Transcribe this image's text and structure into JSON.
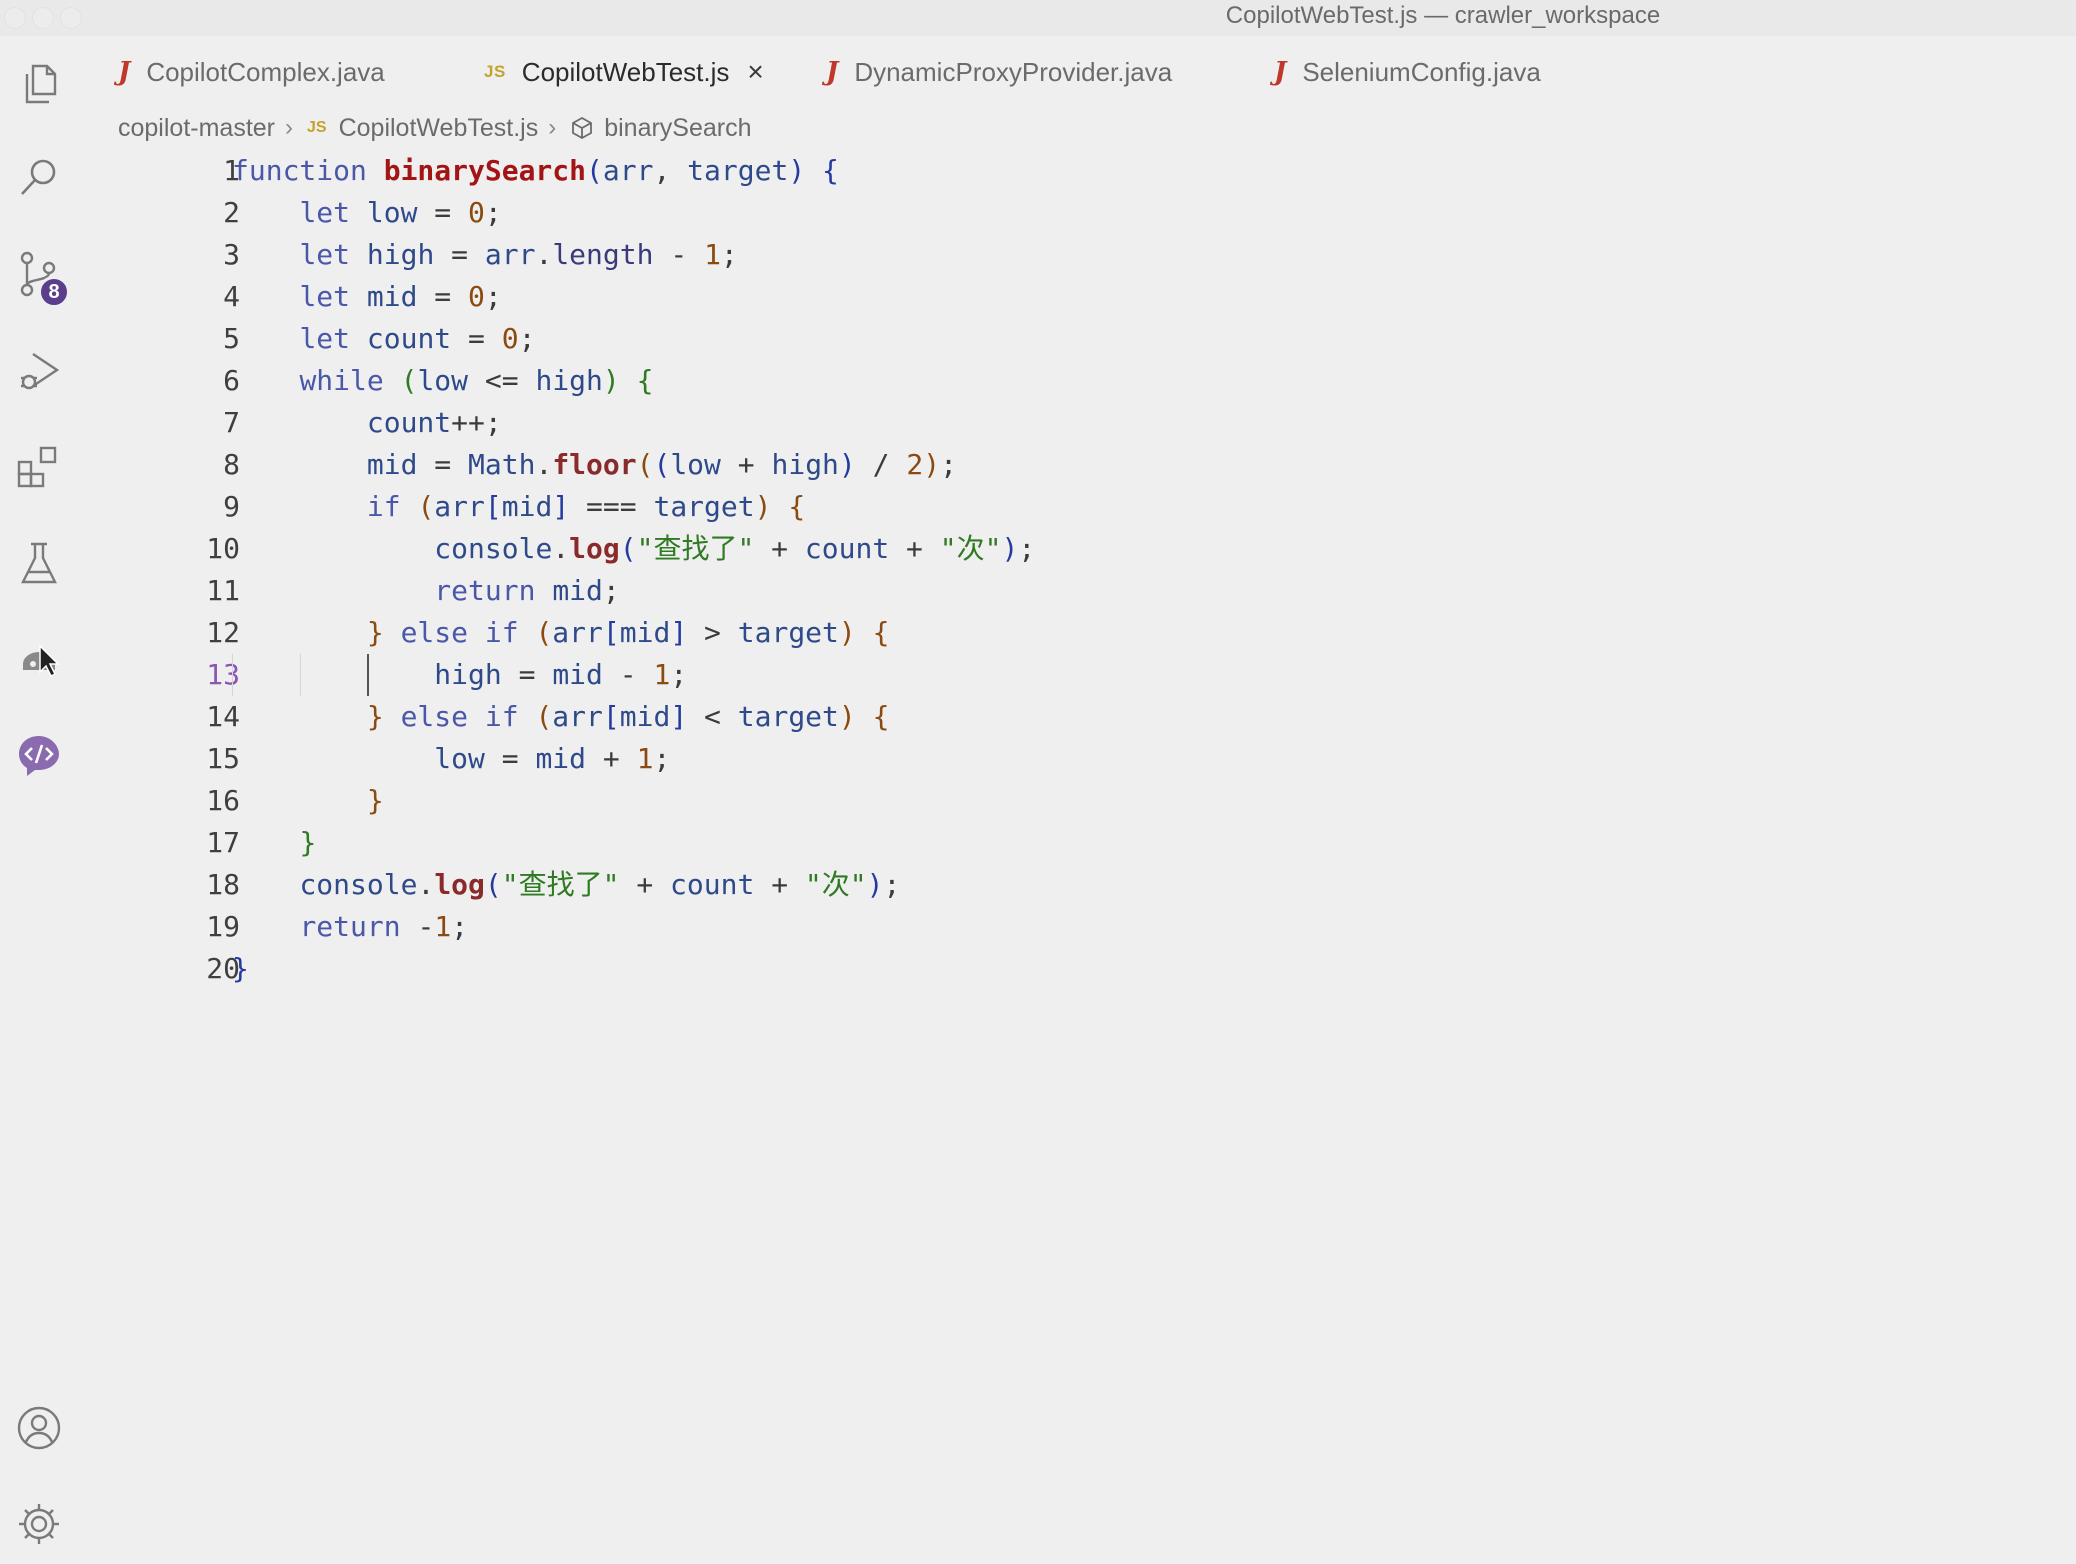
{
  "window": {
    "title": "CopilotWebTest.js — crawler_workspace"
  },
  "activity_bar": {
    "scm_badge": "8"
  },
  "tabs": [
    {
      "label": "CopilotComplex.java",
      "type": "java"
    },
    {
      "label": "CopilotWebTest.js",
      "type": "js",
      "active": true
    },
    {
      "label": "DynamicProxyProvider.java",
      "type": "java"
    },
    {
      "label": "SeleniumConfig.java",
      "type": "java"
    }
  ],
  "tab_icons": {
    "java": "J",
    "js": "JS",
    "close": "×"
  },
  "breadcrumb": {
    "folder": "copilot-master",
    "file": "CopilotWebTest.js",
    "symbol": "binarySearch"
  },
  "editor": {
    "current_line": 13,
    "lines": [
      {
        "n": "1",
        "tokens": [
          [
            "kw",
            "function "
          ],
          [
            "fn",
            "binarySearch"
          ],
          [
            "br1",
            "("
          ],
          [
            "var",
            "arr"
          ],
          [
            "op",
            ", "
          ],
          [
            "var",
            "target"
          ],
          [
            "br1",
            ")"
          ],
          [
            "txt",
            " "
          ],
          [
            "br1",
            "{"
          ]
        ]
      },
      {
        "n": "2",
        "tokens": [
          [
            "txt",
            "    "
          ],
          [
            "kw",
            "let "
          ],
          [
            "var",
            "low"
          ],
          [
            "op",
            " = "
          ],
          [
            "num",
            "0"
          ],
          [
            "op",
            ";"
          ]
        ]
      },
      {
        "n": "3",
        "tokens": [
          [
            "txt",
            "    "
          ],
          [
            "kw",
            "let "
          ],
          [
            "var",
            "high"
          ],
          [
            "op",
            " = "
          ],
          [
            "var",
            "arr"
          ],
          [
            "op",
            "."
          ],
          [
            "prop",
            "length"
          ],
          [
            "op",
            " - "
          ],
          [
            "num",
            "1"
          ],
          [
            "op",
            ";"
          ]
        ]
      },
      {
        "n": "4",
        "tokens": [
          [
            "txt",
            "    "
          ],
          [
            "kw",
            "let "
          ],
          [
            "var",
            "mid"
          ],
          [
            "op",
            " = "
          ],
          [
            "num",
            "0"
          ],
          [
            "op",
            ";"
          ]
        ]
      },
      {
        "n": "5",
        "tokens": [
          [
            "txt",
            "    "
          ],
          [
            "kw",
            "let "
          ],
          [
            "var",
            "count"
          ],
          [
            "op",
            " = "
          ],
          [
            "num",
            "0"
          ],
          [
            "op",
            ";"
          ]
        ]
      },
      {
        "n": "6",
        "tokens": [
          [
            "txt",
            "    "
          ],
          [
            "kw",
            "while "
          ],
          [
            "br2",
            "("
          ],
          [
            "var",
            "low"
          ],
          [
            "op",
            " <= "
          ],
          [
            "var",
            "high"
          ],
          [
            "br2",
            ")"
          ],
          [
            "txt",
            " "
          ],
          [
            "br2",
            "{"
          ]
        ]
      },
      {
        "n": "7",
        "tokens": [
          [
            "txt",
            "        "
          ],
          [
            "var",
            "count"
          ],
          [
            "op",
            "++;"
          ]
        ]
      },
      {
        "n": "8",
        "tokens": [
          [
            "txt",
            "        "
          ],
          [
            "var",
            "mid"
          ],
          [
            "op",
            " = "
          ],
          [
            "var",
            "Math"
          ],
          [
            "op",
            "."
          ],
          [
            "fnc",
            "floor"
          ],
          [
            "br3",
            "("
          ],
          [
            "br1",
            "("
          ],
          [
            "var",
            "low"
          ],
          [
            "op",
            " + "
          ],
          [
            "var",
            "high"
          ],
          [
            "br1",
            ")"
          ],
          [
            "op",
            " / "
          ],
          [
            "num",
            "2"
          ],
          [
            "br3",
            ")"
          ],
          [
            "op",
            ";"
          ]
        ]
      },
      {
        "n": "9",
        "tokens": [
          [
            "txt",
            "        "
          ],
          [
            "kw",
            "if "
          ],
          [
            "br3",
            "("
          ],
          [
            "var",
            "arr"
          ],
          [
            "br1",
            "["
          ],
          [
            "var",
            "mid"
          ],
          [
            "br1",
            "]"
          ],
          [
            "op",
            " === "
          ],
          [
            "var",
            "target"
          ],
          [
            "br3",
            ")"
          ],
          [
            "txt",
            " "
          ],
          [
            "br3",
            "{"
          ]
        ]
      },
      {
        "n": "10",
        "tokens": [
          [
            "txt",
            "            "
          ],
          [
            "var",
            "console"
          ],
          [
            "op",
            "."
          ],
          [
            "fnc",
            "log"
          ],
          [
            "br1",
            "("
          ],
          [
            "str",
            "\"查找了\""
          ],
          [
            "op",
            " + "
          ],
          [
            "var",
            "count"
          ],
          [
            "op",
            " + "
          ],
          [
            "str",
            "\"次\""
          ],
          [
            "br1",
            ")"
          ],
          [
            "op",
            ";"
          ]
        ]
      },
      {
        "n": "11",
        "tokens": [
          [
            "txt",
            "            "
          ],
          [
            "kw",
            "return "
          ],
          [
            "var",
            "mid"
          ],
          [
            "op",
            ";"
          ]
        ]
      },
      {
        "n": "12",
        "tokens": [
          [
            "txt",
            "        "
          ],
          [
            "br3",
            "}"
          ],
          [
            "kw",
            " else if "
          ],
          [
            "br3",
            "("
          ],
          [
            "var",
            "arr"
          ],
          [
            "br1",
            "["
          ],
          [
            "var",
            "mid"
          ],
          [
            "br1",
            "]"
          ],
          [
            "op",
            " > "
          ],
          [
            "var",
            "target"
          ],
          [
            "br3",
            ")"
          ],
          [
            "txt",
            " "
          ],
          [
            "br3",
            "{"
          ]
        ]
      },
      {
        "n": "13",
        "tokens": [
          [
            "txt",
            "            "
          ],
          [
            "var",
            "high"
          ],
          [
            "op",
            " = "
          ],
          [
            "var",
            "mid"
          ],
          [
            "op",
            " - "
          ],
          [
            "num",
            "1"
          ],
          [
            "op",
            ";"
          ]
        ]
      },
      {
        "n": "14",
        "tokens": [
          [
            "txt",
            "        "
          ],
          [
            "br3",
            "}"
          ],
          [
            "kw",
            " else if "
          ],
          [
            "br3",
            "("
          ],
          [
            "var",
            "arr"
          ],
          [
            "br1",
            "["
          ],
          [
            "var",
            "mid"
          ],
          [
            "br1",
            "]"
          ],
          [
            "op",
            " < "
          ],
          [
            "var",
            "target"
          ],
          [
            "br3",
            ")"
          ],
          [
            "txt",
            " "
          ],
          [
            "br3",
            "{"
          ]
        ]
      },
      {
        "n": "15",
        "tokens": [
          [
            "txt",
            "            "
          ],
          [
            "var",
            "low"
          ],
          [
            "op",
            " = "
          ],
          [
            "var",
            "mid"
          ],
          [
            "op",
            " + "
          ],
          [
            "num",
            "1"
          ],
          [
            "op",
            ";"
          ]
        ]
      },
      {
        "n": "16",
        "tokens": [
          [
            "txt",
            "        "
          ],
          [
            "br3",
            "}"
          ]
        ]
      },
      {
        "n": "17",
        "tokens": [
          [
            "txt",
            "    "
          ],
          [
            "br2",
            "}"
          ]
        ]
      },
      {
        "n": "18",
        "tokens": [
          [
            "txt",
            "    "
          ],
          [
            "var",
            "console"
          ],
          [
            "op",
            "."
          ],
          [
            "fnc",
            "log"
          ],
          [
            "br1",
            "("
          ],
          [
            "str",
            "\"查找了\""
          ],
          [
            "op",
            " + "
          ],
          [
            "var",
            "count"
          ],
          [
            "op",
            " + "
          ],
          [
            "str",
            "\"次\""
          ],
          [
            "br1",
            ")"
          ],
          [
            "op",
            ";"
          ]
        ]
      },
      {
        "n": "19",
        "tokens": [
          [
            "txt",
            "    "
          ],
          [
            "kw",
            "return "
          ],
          [
            "op",
            "-"
          ],
          [
            "num",
            "1"
          ],
          [
            "op",
            ";"
          ]
        ]
      },
      {
        "n": "20",
        "tokens": [
          [
            "br1",
            "}"
          ]
        ]
      }
    ]
  },
  "icons": {
    "explorer": "files-icon",
    "search": "search-icon",
    "scm": "source-control-icon",
    "run": "run-debug-icon",
    "extensions": "extensions-icon",
    "testing": "flask-icon",
    "remote": "remote-explorer-icon",
    "copilot": "code-chat-icon",
    "accounts": "account-icon",
    "manage": "gear-icon",
    "symbol": "cube-icon"
  },
  "colors": {
    "badge": "#5b3f8c",
    "java_icon": "#c0382b",
    "js_icon": "#c4a32c",
    "current_line_number": "#8a55b5"
  }
}
